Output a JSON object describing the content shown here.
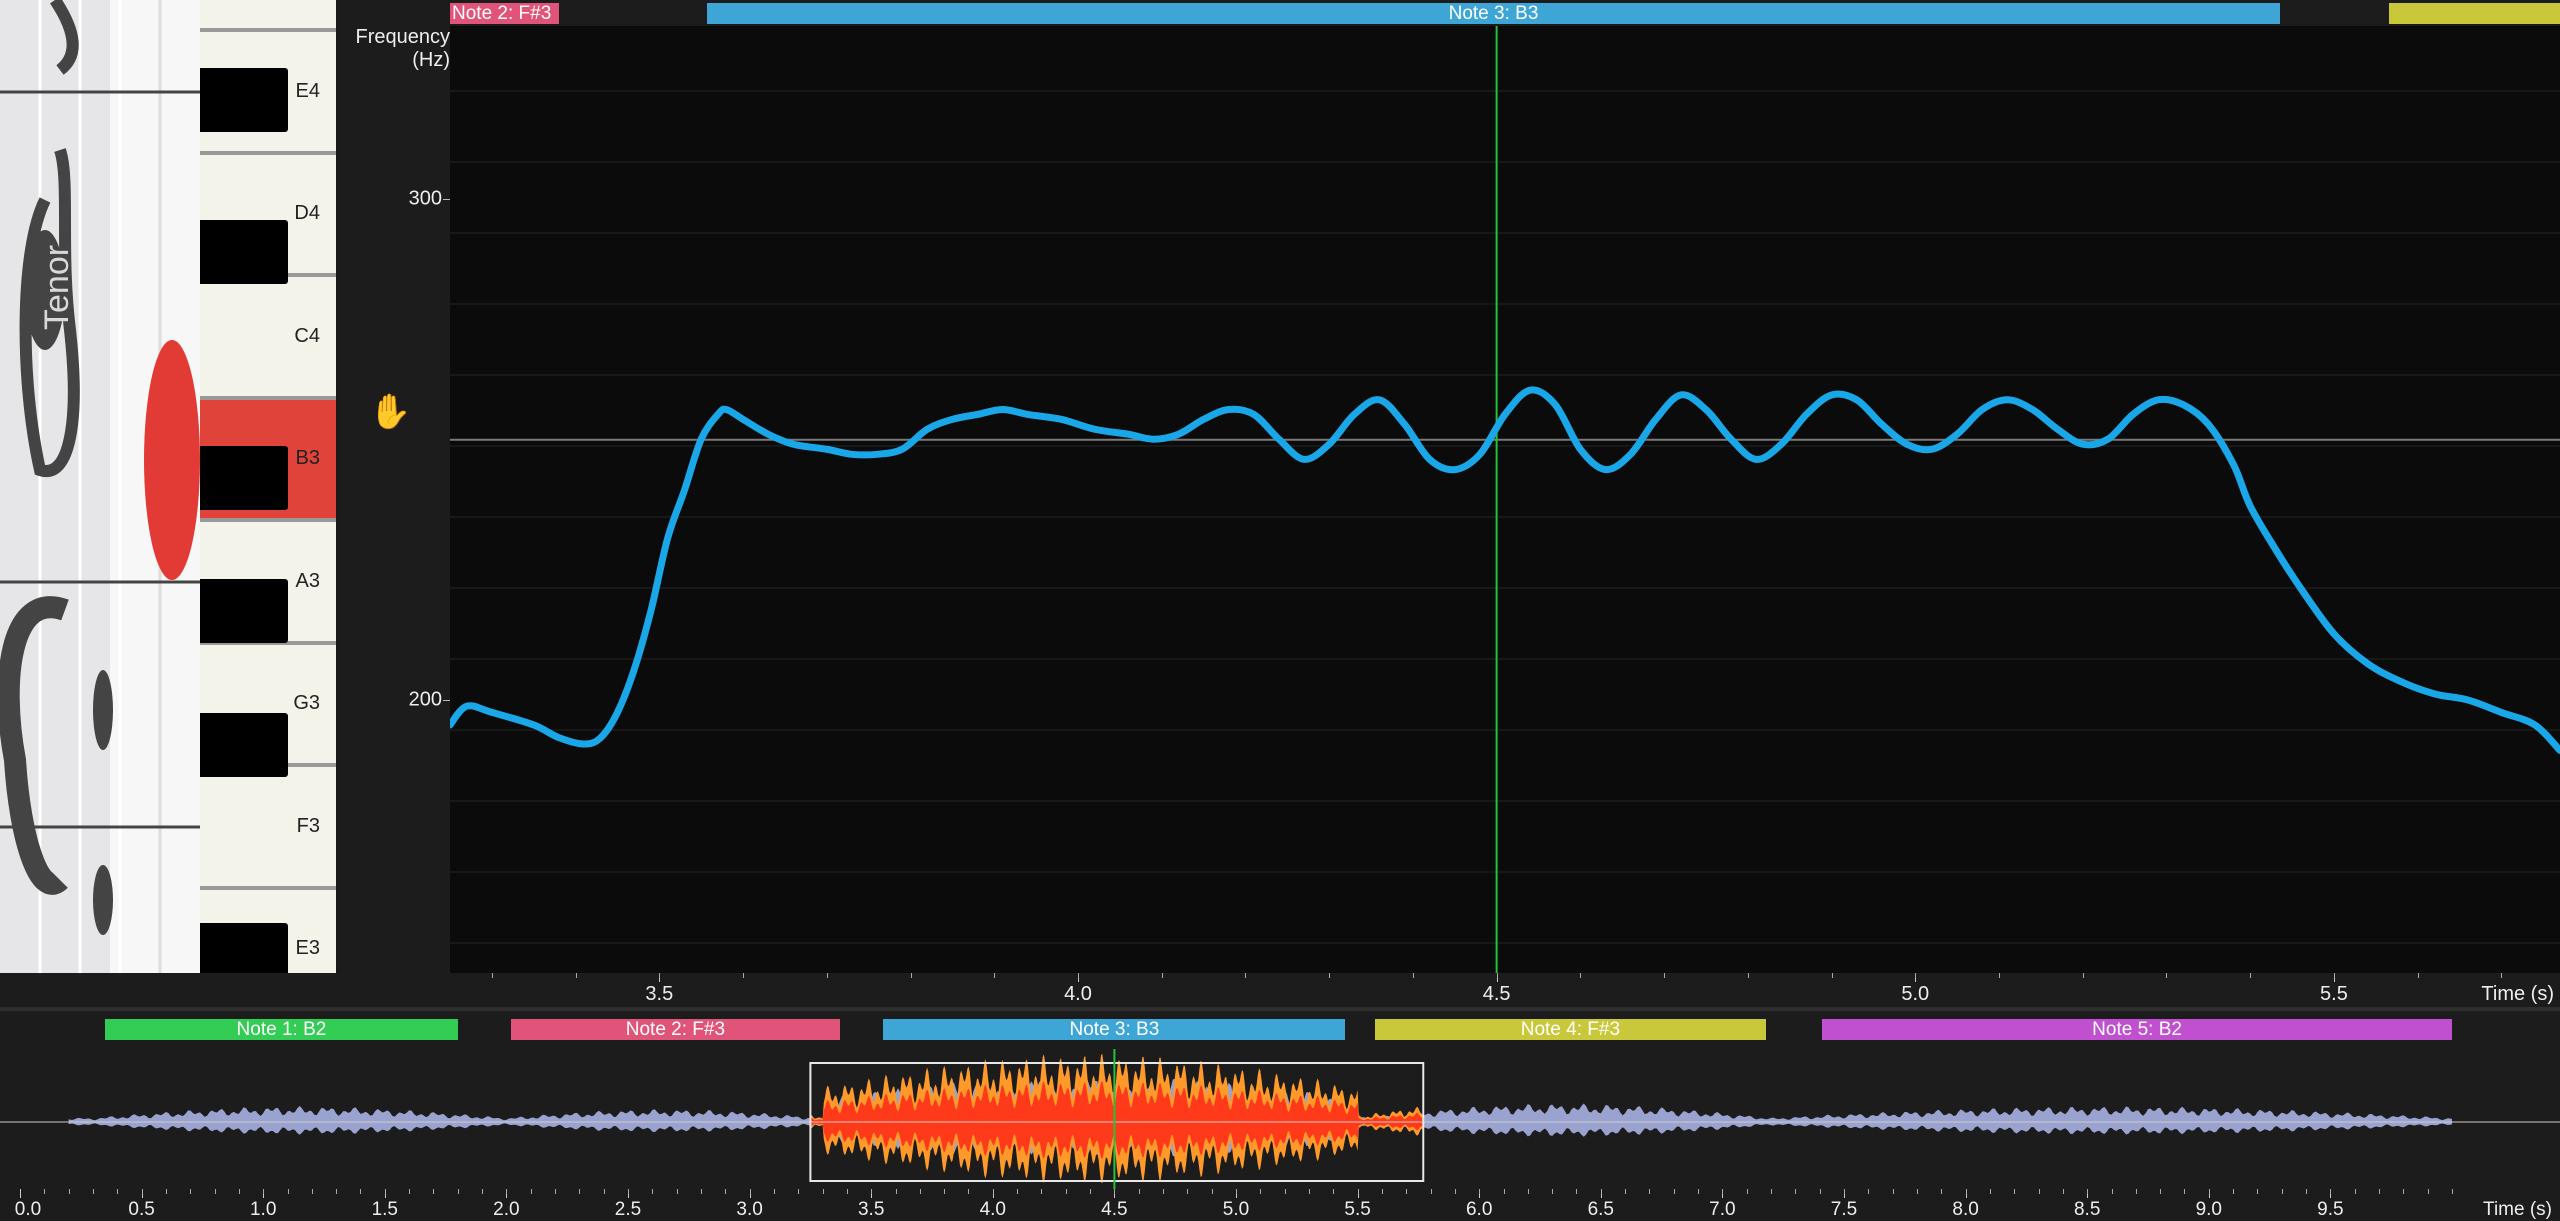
{
  "clef_label": "Tenor",
  "keyboard": {
    "white_keys": [
      "E4",
      "D4",
      "C4",
      "B3",
      "A3",
      "G3",
      "F3",
      "E3"
    ],
    "active_key": "B3"
  },
  "frequency_axis": {
    "title_line1": "Frequency",
    "title_line2": "(Hz)",
    "ticks": [
      "300",
      "200"
    ]
  },
  "time_axis": {
    "label": "Time (s)",
    "ticks": [
      "3.5",
      "4.0",
      "4.5",
      "5.0",
      "5.5"
    ]
  },
  "top_notes": [
    {
      "label": "Note 2: F#3",
      "color": "#e0547a"
    },
    {
      "label": "Note 3: B3",
      "color": "#3ea6d6"
    },
    {
      "label": "",
      "color": "#c8c83a"
    }
  ],
  "overview": {
    "notes": [
      {
        "label": "Note 1: B2",
        "color": "#33cc55"
      },
      {
        "label": "Note 2: F#3",
        "color": "#e0547a"
      },
      {
        "label": "Note 3: B3",
        "color": "#3ea6d6"
      },
      {
        "label": "Note 4: F#3",
        "color": "#c8c83a"
      },
      {
        "label": "Note 5: B2",
        "color": "#c050d0"
      }
    ],
    "time_label": "Time (s)",
    "ticks": [
      "0.0",
      "0.5",
      "1.0",
      "1.5",
      "2.0",
      "2.5",
      "3.0",
      "3.5",
      "4.0",
      "4.5",
      "5.0",
      "5.5",
      "6.0",
      "6.5",
      "7.0",
      "7.5",
      "8.0",
      "8.5",
      "9.0",
      "9.5"
    ],
    "selection_seconds": [
      3.25,
      5.77
    ],
    "cursor_seconds": 4.5
  },
  "colors": {
    "pitch_line": "#1aa7e8",
    "cursor": "#22c23a",
    "waveform": "#9aa3d0",
    "selection_wave_outer": "#ff9a2a",
    "selection_wave_inner": "#ff3a1a",
    "active_key": "#e0433a"
  },
  "chart_data": {
    "type": "line",
    "xlabel": "Time (s)",
    "ylabel": "Frequency (Hz)",
    "xlim": [
      3.25,
      5.77
    ],
    "y_ticks": [
      200,
      300
    ],
    "cursor_x": 4.5,
    "reference_y": 246.9,
    "series": [
      {
        "x": [
          3.25,
          3.27,
          3.3,
          3.35,
          3.38,
          3.41,
          3.43,
          3.45,
          3.47,
          3.49,
          3.51,
          3.53,
          3.55,
          3.57,
          3.58,
          3.6,
          3.63,
          3.66,
          3.7,
          3.73,
          3.76,
          3.79,
          3.82,
          3.85,
          3.88,
          3.91,
          3.94,
          3.98,
          4.02,
          4.06,
          4.09,
          4.12,
          4.15,
          4.18,
          4.21,
          4.24,
          4.27,
          4.3,
          4.33,
          4.36,
          4.39,
          4.42,
          4.45,
          4.48,
          4.51,
          4.54,
          4.57,
          4.6,
          4.63,
          4.66,
          4.69,
          4.72,
          4.75,
          4.78,
          4.81,
          4.84,
          4.87,
          4.9,
          4.93,
          4.96,
          4.99,
          5.02,
          5.05,
          5.08,
          5.11,
          5.14,
          5.17,
          5.2,
          5.23,
          5.26,
          5.29,
          5.32,
          5.35,
          5.38,
          5.4,
          5.43,
          5.46,
          5.5,
          5.54,
          5.58,
          5.62,
          5.66,
          5.7,
          5.74,
          5.77
        ],
        "y": [
          196,
          199,
          198,
          196,
          194,
          193,
          194,
          198,
          205,
          215,
          228,
          237,
          247,
          252,
          253,
          251,
          248,
          246,
          245,
          244,
          244,
          245,
          249,
          251,
          252,
          253,
          252,
          251,
          249,
          248,
          247,
          248,
          251,
          253,
          252,
          247,
          243,
          246,
          252,
          255,
          250,
          243,
          241,
          244,
          252,
          257,
          254,
          245,
          241,
          244,
          251,
          256,
          253,
          247,
          243,
          246,
          252,
          256,
          255,
          250,
          246,
          245,
          248,
          253,
          255,
          253,
          249,
          246,
          247,
          252,
          255,
          254,
          250,
          242,
          234,
          226,
          219,
          211,
          206,
          203,
          201,
          200,
          198,
          196,
          192
        ]
      }
    ]
  }
}
